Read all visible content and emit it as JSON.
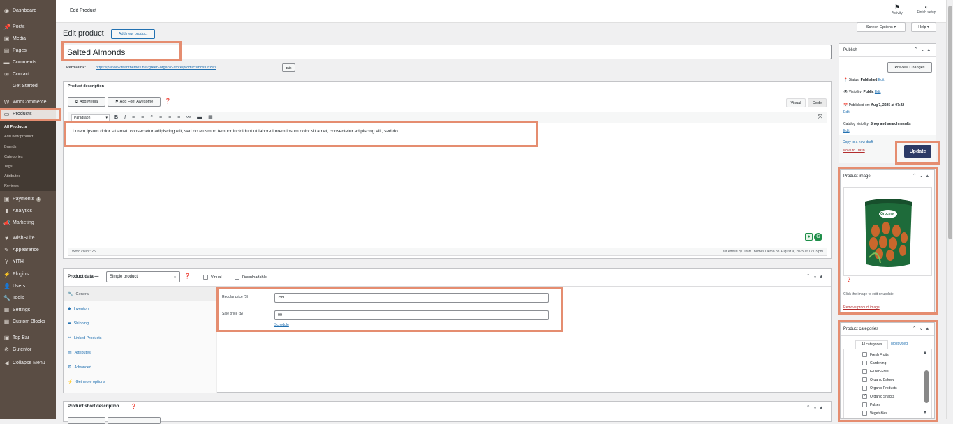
{
  "sidebar": {
    "items": [
      {
        "label": "Dashboard",
        "icon": "dashboard-icon"
      },
      {
        "label": "Posts",
        "icon": "pin-icon"
      },
      {
        "label": "Media",
        "icon": "media-icon"
      },
      {
        "label": "Pages",
        "icon": "pages-icon"
      },
      {
        "label": "Comments",
        "icon": "comments-icon"
      },
      {
        "label": "Contact",
        "icon": "mail-icon"
      },
      {
        "label": "Get Started",
        "icon": ""
      },
      {
        "label": "WooCommerce",
        "icon": "woo-icon"
      },
      {
        "label": "Products",
        "icon": "products-icon"
      },
      {
        "label": "Payments",
        "icon": "payments-icon",
        "badge": "1"
      },
      {
        "label": "Analytics",
        "icon": "analytics-icon"
      },
      {
        "label": "Marketing",
        "icon": "marketing-icon"
      },
      {
        "label": "WishSuite",
        "icon": "heart-icon"
      },
      {
        "label": "Appearance",
        "icon": "appearance-icon"
      },
      {
        "label": "YITH",
        "icon": "yith-icon"
      },
      {
        "label": "Plugins",
        "icon": "plugins-icon"
      },
      {
        "label": "Users",
        "icon": "users-icon"
      },
      {
        "label": "Tools",
        "icon": "tools-icon"
      },
      {
        "label": "Settings",
        "icon": "settings-icon"
      },
      {
        "label": "Custom Blocks",
        "icon": "blocks-icon"
      },
      {
        "label": "Top Bar",
        "icon": "topbar-icon"
      },
      {
        "label": "Gutentor",
        "icon": "gutentor-icon"
      },
      {
        "label": "Collapse Menu",
        "icon": "collapse-icon"
      }
    ],
    "submenu": [
      "All Products",
      "Add new product",
      "Brands",
      "Categories",
      "Tags",
      "Attributes",
      "Reviews"
    ]
  },
  "topbar": {
    "title": "Edit Product",
    "activity": "Activity",
    "finish_setup": "Finish setup"
  },
  "header": {
    "heading": "Edit product",
    "add_new": "Add new product",
    "screen_options": "Screen Options ▾",
    "help": "Help ▾"
  },
  "product": {
    "title": "Salted Almonds",
    "permalink_label": "Permalink:",
    "permalink_url": "https://preview.titanthemes.net/green-organic-store/product/mosturizer/",
    "edit": "Edit"
  },
  "description": {
    "heading": "Product description",
    "add_media": "Add Media",
    "add_font_awesome": "Add Font Awesome",
    "visual": "Visual",
    "code": "Code",
    "format": "Paragraph",
    "content": "Lorem ipsum dolor sit amet, consectetur adipiscing elit, sed do eiusmod tempor incididunt ut labore Lorem ipsum dolor sit amet, consectetur adipiscing elit, sed do…",
    "word_count": "Word count: 25",
    "last_edited": "Last edited by Titan Themes Demo on August 9, 2025 at 12:03 pm"
  },
  "product_data": {
    "label": "Product data —",
    "type": "Simple product",
    "virtual": "Virtual",
    "downloadable": "Downloadable",
    "tabs": [
      "General",
      "Inventory",
      "Shipping",
      "Linked Products",
      "Attributes",
      "Advanced",
      "Get more options"
    ],
    "regular_price_label": "Regular price ($)",
    "regular_price": "299",
    "sale_price_label": "Sale price ($)",
    "sale_price": "99",
    "schedule": "Schedule"
  },
  "short_description": {
    "heading": "Product short description"
  },
  "publish": {
    "heading": "Publish",
    "preview": "Preview Changes",
    "status_label": "Status:",
    "status": "Published",
    "status_edit": "Edit",
    "visibility_label": "Visibility:",
    "visibility": "Public",
    "visibility_edit": "Edit",
    "published_label": "Published on:",
    "published": "Aug 7, 2025 at 07:22",
    "published_edit": "Edit",
    "catalog_label": "Catalog visibility:",
    "catalog": "Shop and search results",
    "catalog_edit": "Edit",
    "copy": "Copy to a new draft",
    "trash": "Move to Trash",
    "update": "Update"
  },
  "product_image": {
    "heading": "Product image",
    "brand_text": "Grocery",
    "hint": "Click the image to edit or update",
    "remove": "Remove product image"
  },
  "categories": {
    "heading": "Product categories",
    "tab_all": "All categories",
    "tab_used": "Most Used",
    "items": [
      {
        "name": "Fresh Fruits",
        "checked": false
      },
      {
        "name": "Gardening",
        "checked": false
      },
      {
        "name": "Gluten-Free",
        "checked": false
      },
      {
        "name": "Organic Bakery",
        "checked": false
      },
      {
        "name": "Organic Products",
        "checked": false
      },
      {
        "name": "Organic Snacks",
        "checked": true
      },
      {
        "name": "Pulses",
        "checked": false
      },
      {
        "name": "Vegetables",
        "checked": false
      }
    ]
  },
  "colors": {
    "sidebar": "#5a4d44",
    "accent": "#e58d70",
    "link": "#2271b1",
    "update_btn": "#2c3a66"
  }
}
